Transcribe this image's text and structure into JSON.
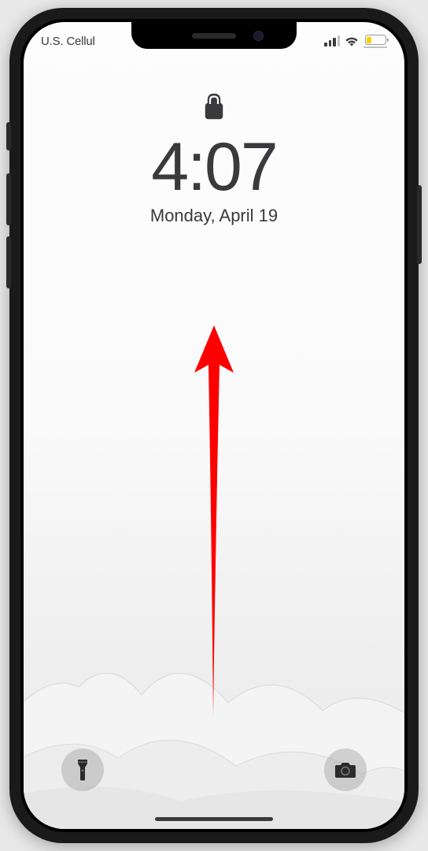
{
  "status": {
    "carrier": "U.S. Cellul",
    "signal_bars": 3,
    "signal_total": 4,
    "wifi_strength": 3,
    "battery_percent": 25,
    "battery_low_power": true,
    "battery_color": "#ffcc00"
  },
  "lock": {
    "locked": true,
    "time": "4:07",
    "date": "Monday, April 19"
  },
  "buttons": {
    "flashlight": "flashlight",
    "camera": "camera"
  },
  "annotation": {
    "type": "arrow",
    "direction": "up",
    "color": "#ff0000"
  }
}
